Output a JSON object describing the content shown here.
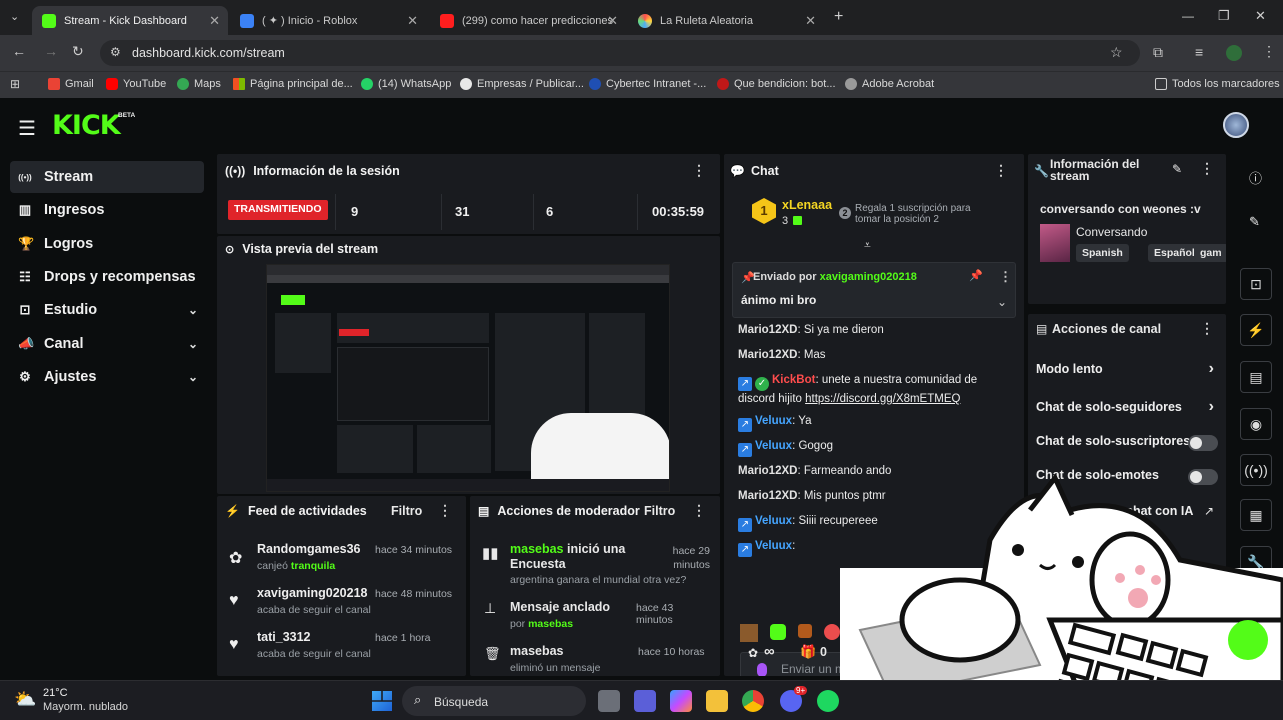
{
  "browser": {
    "tabs": [
      {
        "label": "Stream - Kick Dashboard",
        "active": true
      },
      {
        "label": "( ✦ ) Inicio - Roblox",
        "active": false
      },
      {
        "label": "(299) como hacer predicciones",
        "active": false
      },
      {
        "label": "La Ruleta Aleatoria",
        "active": false
      }
    ],
    "new_tab": "+",
    "url": "dashboard.kick.com/stream",
    "bookmarks": [
      "Gmail",
      "YouTube",
      "Maps",
      "Página principal de...",
      "(14) WhatsApp",
      "Empresas / Publicar...",
      "Cybertec Intranet -...",
      "Que bendicion: bot...",
      "Adobe Acrobat"
    ],
    "all_bookmarks": "Todos los marcadores",
    "window_controls": {
      "minimize": "—",
      "restore": "❐",
      "close": "✕"
    }
  },
  "kick": {
    "logo": "KICK",
    "beta": "BETA",
    "nav": [
      {
        "label": "Stream",
        "icon": "broadcast-icon",
        "active": true,
        "has_chevron": false
      },
      {
        "label": "Ingresos",
        "icon": "chart-icon",
        "active": false,
        "has_chevron": false
      },
      {
        "label": "Logros",
        "icon": "trophy-icon",
        "active": false,
        "has_chevron": false
      },
      {
        "label": "Drops y recompensas",
        "icon": "gift-icon",
        "active": false,
        "has_chevron": false
      },
      {
        "label": "Estudio",
        "icon": "studio-icon",
        "active": false,
        "has_chevron": true
      },
      {
        "label": "Canal",
        "icon": "megaphone-icon",
        "active": false,
        "has_chevron": true
      },
      {
        "label": "Ajustes",
        "icon": "gear-icon",
        "active": false,
        "has_chevron": true
      }
    ],
    "session": {
      "title": "Información de la sesión",
      "status": "TRANSMITIENDO",
      "viewers": "9",
      "followers": "31",
      "subs": "6",
      "duration": "00:35:59"
    },
    "preview": {
      "title": "Vista previa del stream"
    },
    "activity_feed": {
      "title": "Feed de actividades",
      "filter": "Filtro",
      "items": [
        {
          "name": "Randomgames36",
          "time": "hace 34 minutos",
          "desc": "canjeó ",
          "highlight": "tranquila"
        },
        {
          "name": "xavigaming020218",
          "time": "hace 48 minutos",
          "desc": "acaba de seguir el canal",
          "highlight": ""
        },
        {
          "name": "tati_3312",
          "time": "hace 1 hora",
          "desc": "acaba de seguir el canal",
          "highlight": ""
        }
      ]
    },
    "mod_actions": {
      "title": "Acciones de moderador",
      "filter": "Filtro",
      "items": [
        {
          "user": "masebas",
          "action": " inició una Encuesta",
          "time": "hace 29 minutos",
          "detail": "argentina ganara el mundial otra vez?"
        },
        {
          "user": "Mensaje anclado",
          "action": "",
          "time": "hace 43 minutos",
          "detail_prefix": "por ",
          "detail": "masebas"
        },
        {
          "user": "masebas",
          "action": "",
          "time": "hace 10 horas",
          "detail": "eliminó un mensaje"
        }
      ]
    },
    "chat": {
      "title": "Chat",
      "top_gifter": "xLenaaa",
      "top_gifter_count": "3",
      "gift_prompt_num": "2",
      "gift_prompt": "Regala 1 suscripción para tomar la posición 2",
      "pinned_by_label": "Enviado por ",
      "pinned_by": "xavigaming020218",
      "pinned_msg": "ánimo mi bro",
      "messages": [
        {
          "user": "Mario12XD",
          "type": "m",
          "text": ": Si ya me dieron"
        },
        {
          "user": "Mario12XD",
          "type": "m",
          "text": ": Mas"
        },
        {
          "user": "KickBot",
          "type": "k",
          "text": ": unete a nuestra comunidad de discord hijito ",
          "link": "https://discord.gg/X8mETMEQ"
        },
        {
          "user": "Veluux",
          "type": "v",
          "text": ": Ya"
        },
        {
          "user": "Veluux",
          "type": "v",
          "text": ": Gogog"
        },
        {
          "user": "Mario12XD",
          "type": "m",
          "text": ": Farmeando ando"
        },
        {
          "user": "Mario12XD",
          "type": "m",
          "text": ": Mis puntos ptmr"
        },
        {
          "user": "Veluux",
          "type": "v",
          "text": ": Siiii recupereee"
        },
        {
          "user": "Veluux",
          "type": "v",
          "text": ":"
        }
      ],
      "input_placeholder": "Enviar un m",
      "points": "∞",
      "gifts": "0"
    },
    "stream_info": {
      "title": "Información del stream",
      "stream_title": "conversando con weones :v",
      "category": "Conversando",
      "tags": [
        "Spanish",
        "Español",
        "gam"
      ]
    },
    "channel_actions": {
      "title": "Acciones de canal",
      "items": [
        {
          "label": "Modo lento",
          "control": "chevron"
        },
        {
          "label": "Chat de solo-seguidores",
          "control": "chevron"
        },
        {
          "label": "Chat de solo-suscriptores",
          "control": "toggle"
        },
        {
          "label": "Chat de solo-emotes",
          "control": "toggle"
        },
        {
          "label": "chat con IA",
          "control": "external"
        }
      ]
    }
  },
  "taskbar": {
    "weather_temp": "21°C",
    "weather_desc": "Mayorm. nublado",
    "search": "Búsqueda",
    "discord_badge": "9+"
  },
  "colors": {
    "kick_green": "#53fc18",
    "live_red": "#e0242a",
    "panel": "#191b1f",
    "bg": "#0b0d0e"
  }
}
